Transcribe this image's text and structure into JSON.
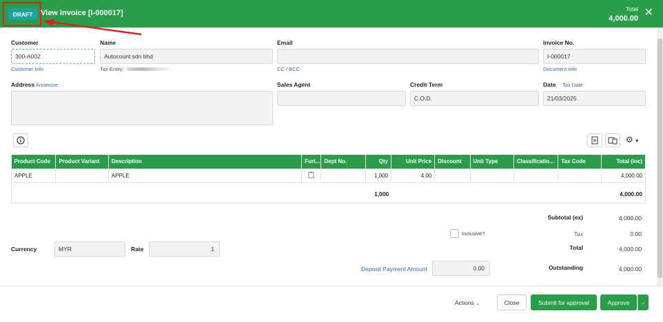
{
  "header": {
    "status_badge": "DRAFT",
    "title": "View Invoice [I-000017]",
    "total_label": "Total",
    "total_value": "4,000.00"
  },
  "form": {
    "customer_label": "Customer",
    "customer_value": "300-A002",
    "customer_info_link": "Customer Info",
    "name_label": "Name",
    "name_value": "Autocount sdn bhd",
    "tax_entity_label": "Tax Entity:",
    "email_label": "Email",
    "email_value": "",
    "cc_bcc_link": "CC / BCC",
    "invoice_no_label": "Invoice No.",
    "invoice_no_value": "I-000017",
    "document_info_link": "Document Info",
    "address_label": "Address",
    "annexure_link": "Annexure",
    "address_value": "",
    "sales_agent_label": "Sales Agent",
    "sales_agent_value": "",
    "credit_term_label": "Credit Term",
    "credit_term_value": "C.O.D.",
    "date_label": "Date",
    "tax_date_link": "Tax Date",
    "date_value": "21/03/2025"
  },
  "grid": {
    "columns": [
      "Product Code",
      "Product Variant",
      "Description",
      "Furt...",
      "Dept No.",
      "Qty",
      "Unit Price",
      "Discount",
      "Unit Type",
      "Classificatio...",
      "Tax Code",
      "Total (inc)"
    ],
    "rows": [
      {
        "product_code": "APPLE",
        "product_variant": "",
        "description": "APPLE",
        "dept_no": "",
        "qty": "1,000",
        "unit_price": "4.00",
        "discount": "",
        "unit_type": "",
        "classification": "",
        "tax_code": "",
        "total": "4,000.00"
      }
    ],
    "sum_qty": "1,000",
    "sum_total": "4,000.00"
  },
  "summary": {
    "subtotal_label": "Subtotal (ex)",
    "subtotal_value": "4,000.00",
    "inclusive_label": "Inclusive?",
    "tax_label": "Tax",
    "tax_value": "0.00",
    "total_label": "Total",
    "total_value": "4,000.00",
    "outstanding_label": "Outstanding",
    "outstanding_value": "4,000.00",
    "currency_label": "Currency",
    "currency_value": "MYR",
    "rate_label": "Rate",
    "rate_value": "1",
    "deposit_label": "Deposit Payment Amount",
    "deposit_value": "0.00"
  },
  "footer": {
    "actions_label": "Actions",
    "close_label": "Close",
    "submit_label": "Submit for approval",
    "approve_label": "Approve"
  },
  "colors": {
    "brand_green": "#2a9d4a",
    "draft_badge": "#1aa3a0",
    "annotation_red": "#e02020",
    "link_blue": "#2b6cb0"
  }
}
